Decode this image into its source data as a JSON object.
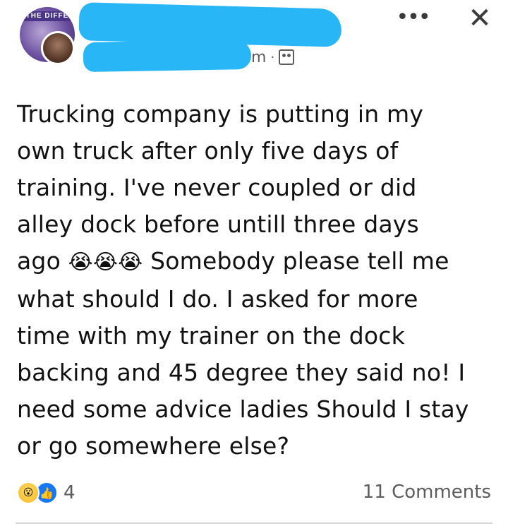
{
  "header": {
    "group_avatar_banner": "THE DIFFE",
    "time_fragment": "m",
    "separator": "·",
    "icons": {
      "audience": "group-icon",
      "more": "more-icon",
      "close": "close-icon"
    },
    "more_glyph": "•••",
    "close_glyph": "✕",
    "redaction_color": "#29b6f6"
  },
  "post": {
    "lines": [
      "Trucking company is putting in my",
      "own truck after only five days of",
      "training. I've never coupled or did",
      "alley dock before untill three days",
      "ago",
      "Somebody please tell me",
      "what should I do. I asked for more",
      "time with my trainer on the dock",
      "backing and 45 degree they said no! I",
      "need some advice ladies Should I stay",
      "or go somewhere else?"
    ],
    "emoji_sequence": "😭😭😭"
  },
  "footer": {
    "reaction_icons": [
      "wow-icon",
      "like-icon"
    ],
    "reaction_count": "4",
    "comments_label": "11 Comments",
    "accent_color": "#1877f2"
  }
}
